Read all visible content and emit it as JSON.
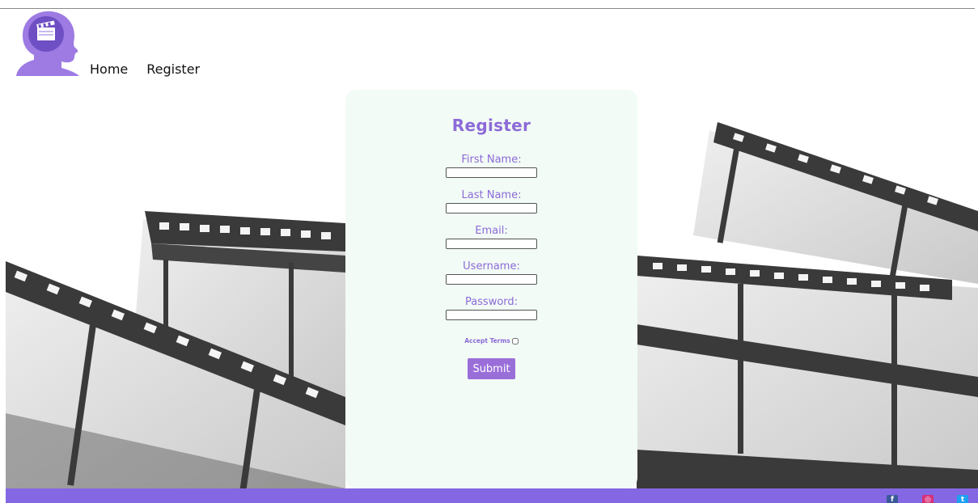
{
  "header": {
    "logo_icon": "clapperboard-head-icon",
    "nav": [
      {
        "label": "Home"
      },
      {
        "label": "Register"
      }
    ]
  },
  "hero": {
    "background_icon": "film-reel-icon"
  },
  "form": {
    "title": "Register",
    "fields": [
      {
        "label": "First Name:",
        "value": ""
      },
      {
        "label": "Last Name:",
        "value": ""
      },
      {
        "label": "Email:",
        "value": ""
      },
      {
        "label": "Username:",
        "value": ""
      },
      {
        "label": "Password:",
        "value": ""
      }
    ],
    "accept_terms_label": "Accept Terms",
    "accept_terms_checked": false,
    "submit_label": "Submit"
  },
  "footer": {
    "social": [
      {
        "icon": "facebook-icon",
        "glyph": "f"
      },
      {
        "icon": "instagram-icon",
        "glyph": "◎"
      },
      {
        "icon": "twitter-icon",
        "glyph": "t"
      }
    ]
  },
  "colors": {
    "accent": "#8c6ad8",
    "footer": "#8468e3",
    "card_bg": "#f2fbf5",
    "button": "#9a6ed9"
  }
}
